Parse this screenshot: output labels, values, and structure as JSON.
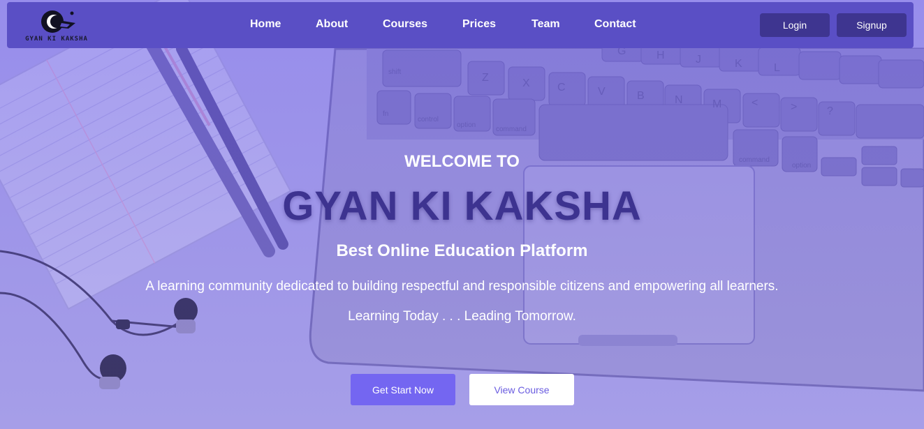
{
  "brand": {
    "logo_text": "GYAN KI KAKSHA"
  },
  "nav": {
    "links": [
      "Home",
      "About",
      "Courses",
      "Prices",
      "Team",
      "Contact"
    ],
    "login_label": "Login",
    "signup_label": "Signup"
  },
  "hero": {
    "welcome": "WELCOME TO",
    "title": "GYAN KI KAKSHA",
    "tagline": "Best Online Education Platform",
    "description": "A learning community dedicated to building respectful and responsible citizens and empowering all learners.",
    "motto": "Learning Today . . . Leading Tomorrow.",
    "primary_button": "Get Start Now",
    "secondary_button": "View Course"
  },
  "colors": {
    "navbar": "#5a4fc5",
    "nav_button": "#3e3590",
    "accent": "#7466f1",
    "title": "#3d3390"
  },
  "keyboard": {
    "row1": [
      "G",
      "H",
      "J",
      "K",
      "L"
    ],
    "row2": [
      "shift",
      "Z",
      "X",
      "C",
      "V",
      "B",
      "N",
      "M",
      "<",
      ">",
      "?"
    ],
    "row3": [
      "fn",
      "control",
      "option",
      "command",
      "command",
      "option"
    ]
  }
}
